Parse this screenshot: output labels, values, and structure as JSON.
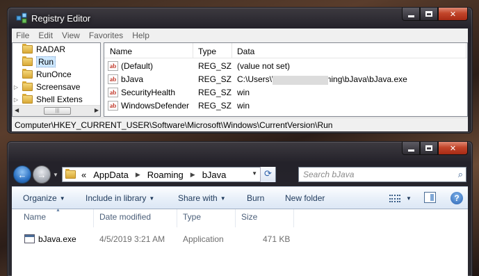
{
  "registry": {
    "title": "Registry Editor",
    "menu": [
      "File",
      "Edit",
      "View",
      "Favorites",
      "Help"
    ],
    "tree": [
      {
        "label": "RADAR",
        "expander": ""
      },
      {
        "label": "Run",
        "expander": "",
        "selected": true
      },
      {
        "label": "RunOnce",
        "expander": ""
      },
      {
        "label": "Screensave",
        "expander": "▷"
      },
      {
        "label": "Shell Extens",
        "expander": "▷"
      }
    ],
    "columns": {
      "name": "Name",
      "type": "Type",
      "data": "Data"
    },
    "values": [
      {
        "name": "(Default)",
        "type": "REG_SZ",
        "data_pre": "(value not set)",
        "data_post": ""
      },
      {
        "name": "bJava",
        "type": "REG_SZ",
        "data_pre": "C:\\Users\\",
        "data_post": "\\AppData\\Roaming\\bJava\\bJava.exe"
      },
      {
        "name": "SecurityHealth",
        "type": "REG_SZ",
        "data_pre": "win",
        "data_post": ""
      },
      {
        "name": "WindowsDefender",
        "type": "REG_SZ",
        "data_pre": "win",
        "data_post": ""
      }
    ],
    "status_path": "Computer\\HKEY_CURRENT_USER\\Software\\Microsoft\\Windows\\CurrentVersion\\Run",
    "icon_names": {
      "value": "string-value-icon",
      "folder": "folder-icon"
    }
  },
  "explorer": {
    "breadcrumb": {
      "prefix": "«",
      "items": [
        "AppData",
        "Roaming",
        "bJava"
      ]
    },
    "search_placeholder": "Search bJava",
    "commands": {
      "organize": "Organize",
      "include": "Include in library",
      "share": "Share with",
      "burn": "Burn",
      "new_folder": "New folder"
    },
    "columns": {
      "name": "Name",
      "date": "Date modified",
      "type": "Type",
      "size": "Size"
    },
    "files": [
      {
        "name": "bJava.exe",
        "date": "4/5/2019 3:21 AM",
        "type": "Application",
        "size": "471 KB"
      }
    ]
  },
  "colors": {
    "accent": "#2e74c5",
    "close": "#c2452a",
    "selection": "#cde8ff"
  }
}
